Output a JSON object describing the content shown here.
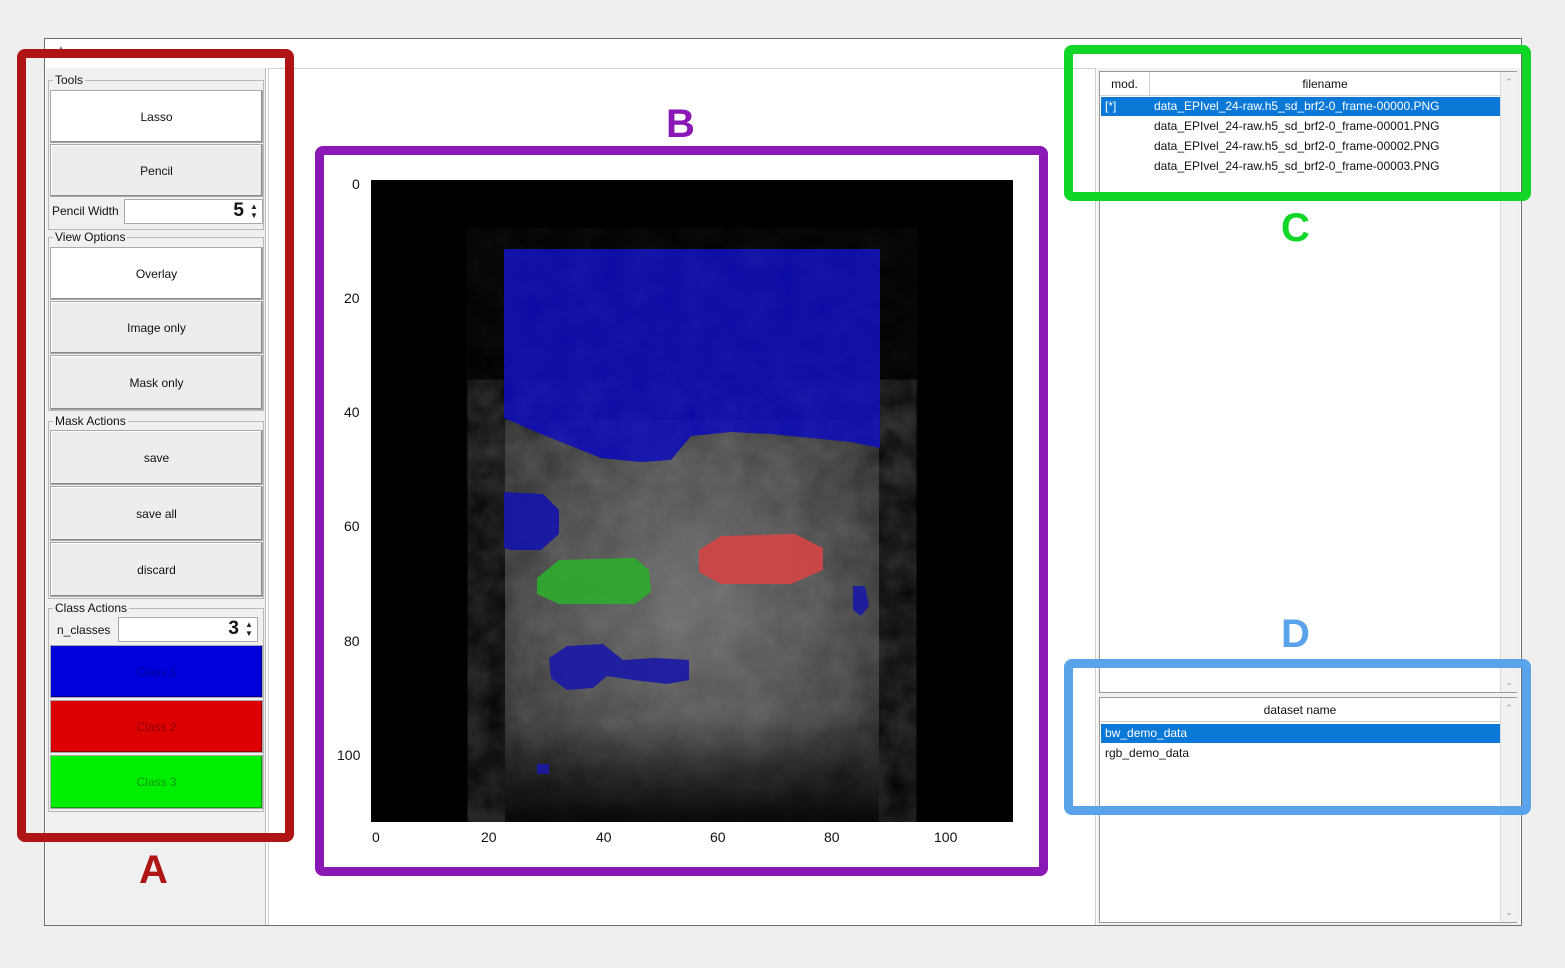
{
  "tools": {
    "title": "Tools",
    "lasso_label": "Lasso",
    "pencil_label": "Pencil",
    "pencil_width_label": "Pencil Width",
    "pencil_width_value": "5"
  },
  "view_options": {
    "title": "View Options",
    "overlay_label": "Overlay",
    "image_only_label": "Image only",
    "mask_only_label": "Mask only"
  },
  "mask_actions": {
    "title": "Mask Actions",
    "save_label": "save",
    "save_all_label": "save all",
    "discard_label": "discard"
  },
  "class_actions": {
    "title": "Class Actions",
    "n_classes_label": "n_classes",
    "n_classes_value": "3",
    "classes": [
      {
        "label": "Class 1",
        "color": "#0000dd"
      },
      {
        "label": "Class 2",
        "color": "#dd0000"
      },
      {
        "label": "Class 3",
        "color": "#00ee00"
      }
    ]
  },
  "image_view": {
    "y_ticks": [
      "0",
      "20",
      "40",
      "60",
      "80",
      "100"
    ],
    "x_ticks": [
      "0",
      "20",
      "40",
      "60",
      "80",
      "100"
    ]
  },
  "file_table": {
    "col_mod": "mod.",
    "col_filename": "filename",
    "rows": [
      {
        "mod": "[*]",
        "filename": "data_EPIvel_24-raw.h5_sd_brf2-0_frame-00000.PNG",
        "selected": true
      },
      {
        "mod": "",
        "filename": "data_EPIvel_24-raw.h5_sd_brf2-0_frame-00001.PNG",
        "selected": false
      },
      {
        "mod": "",
        "filename": "data_EPIvel_24-raw.h5_sd_brf2-0_frame-00002.PNG",
        "selected": false
      },
      {
        "mod": "",
        "filename": "data_EPIvel_24-raw.h5_sd_brf2-0_frame-00003.PNG",
        "selected": false
      }
    ]
  },
  "dataset_table": {
    "col_name": "dataset name",
    "rows": [
      {
        "name": "bw_demo_data",
        "selected": true
      },
      {
        "name": "rgb_demo_data",
        "selected": false
      }
    ]
  },
  "annotations": [
    {
      "label": "A",
      "color": "#b01515"
    },
    {
      "label": "B",
      "color": "#8a18b4"
    },
    {
      "label": "C",
      "color": "#10d628"
    },
    {
      "label": "D",
      "color": "#5aa2ea"
    }
  ]
}
